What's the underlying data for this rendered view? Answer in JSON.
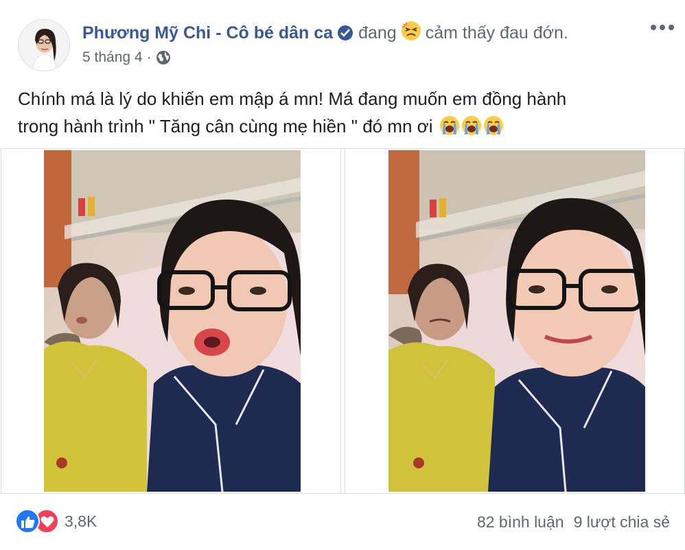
{
  "post": {
    "author": "Phương Mỹ Chi - Cô bé dân ca",
    "feeling_prefix": "đang",
    "feeling_text": "cảm thấy đau đớn.",
    "feeling_icon": "pained-face-emoji",
    "date": "5 tháng 4",
    "privacy_icon": "globe-icon",
    "text_line_1": "Chính má là lý do khiến em mập á mn! Má đang muốn em đồng hành",
    "text_line_2": "trong hành trình \" Tăng cân cùng mẹ hiền \" đó mn ơi",
    "text_emoji": "loudly-crying-face-emoji",
    "text_emoji_count": 3
  },
  "footer": {
    "reaction_icons": [
      "like-icon",
      "love-icon"
    ],
    "reaction_count": "3,8K",
    "comments": "82 bình luận",
    "shares": "9 lượt chia sẻ"
  },
  "colors": {
    "author_blue": "#385898",
    "meta_gray": "#606770",
    "like_blue": "#2078f4",
    "love_red": "#f33e58",
    "divider": "#dadde1"
  }
}
